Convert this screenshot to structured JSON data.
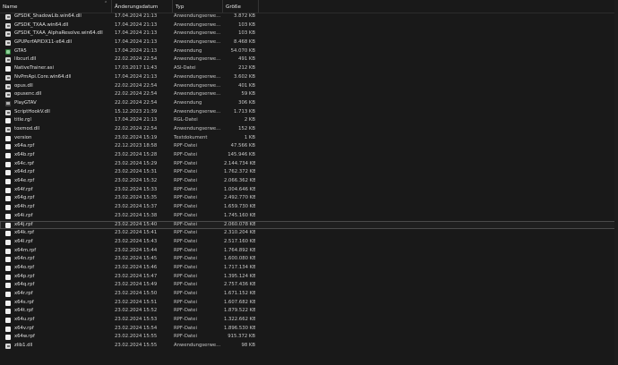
{
  "headers": {
    "name": "Name",
    "date": "Änderungsdatum",
    "type": "Typ",
    "size": "Größe"
  },
  "rows": [
    {
      "name": "GFSDK_ShadowLib.win64.dll",
      "date": "17.04.2024 21:13",
      "type": "Anwendungserwe...",
      "size": "3.872 KB",
      "icon": "dll-icon"
    },
    {
      "name": "GFSDK_TXAA.win64.dll",
      "date": "17.04.2024 21:13",
      "type": "Anwendungserwe...",
      "size": "103 KB",
      "icon": "dll-icon"
    },
    {
      "name": "GFSDK_TXAA_AlphaResolve.win64.dll",
      "date": "17.04.2024 21:13",
      "type": "Anwendungserwe...",
      "size": "103 KB",
      "icon": "dll-icon"
    },
    {
      "name": "GPUPerfAPIDX11-x64.dll",
      "date": "17.04.2024 21:13",
      "type": "Anwendungserwe...",
      "size": "8.468 KB",
      "icon": "dll-icon"
    },
    {
      "name": "GTA5",
      "date": "17.04.2024 21:13",
      "type": "Anwendung",
      "size": "54.070 KB",
      "icon": "app-icon"
    },
    {
      "name": "libcurl.dll",
      "date": "22.02.2024 22:54",
      "type": "Anwendungserwe...",
      "size": "491 KB",
      "icon": "dll-icon"
    },
    {
      "name": "NativeTrainer.asi",
      "date": "17.03.2017 11:43",
      "type": "ASI-Datei",
      "size": "212 KB",
      "icon": "file-icon"
    },
    {
      "name": "NvPmApi.Core.win64.dll",
      "date": "17.04.2024 21:13",
      "type": "Anwendungserwe...",
      "size": "3.602 KB",
      "icon": "dll-icon"
    },
    {
      "name": "opus.dll",
      "date": "22.02.2024 22:54",
      "type": "Anwendungserwe...",
      "size": "401 KB",
      "icon": "dll-icon"
    },
    {
      "name": "opusenc.dll",
      "date": "22.02.2024 22:54",
      "type": "Anwendungserwe...",
      "size": "59 KB",
      "icon": "dll-icon"
    },
    {
      "name": "PlayGTAV",
      "date": "22.02.2024 22:54",
      "type": "Anwendung",
      "size": "306 KB",
      "icon": "app2-icon"
    },
    {
      "name": "ScriptHookV.dll",
      "date": "15.12.2023 21:39",
      "type": "Anwendungserwe...",
      "size": "1.713 KB",
      "icon": "dll-icon"
    },
    {
      "name": "title.rgl",
      "date": "17.04.2024 21:13",
      "type": "RGL-Datei",
      "size": "2 KB",
      "icon": "file-icon"
    },
    {
      "name": "toxmod.dll",
      "date": "22.02.2024 22:54",
      "type": "Anwendungserwe...",
      "size": "152 KB",
      "icon": "dll-icon"
    },
    {
      "name": "version",
      "date": "23.02.2024 15:19",
      "type": "Textdokument",
      "size": "1 KB",
      "icon": "file-icon"
    },
    {
      "name": "x64a.rpf",
      "date": "22.12.2023 18:58",
      "type": "RPF-Datei",
      "size": "47.566 KB",
      "icon": "file-icon"
    },
    {
      "name": "x64b.rpf",
      "date": "23.02.2024 15:28",
      "type": "RPF-Datei",
      "size": "145.946 KB",
      "icon": "file-icon"
    },
    {
      "name": "x64c.rpf",
      "date": "23.02.2024 15:29",
      "type": "RPF-Datei",
      "size": "2.144.734 KB",
      "icon": "file-icon"
    },
    {
      "name": "x64d.rpf",
      "date": "23.02.2024 15:31",
      "type": "RPF-Datei",
      "size": "1.762.372 KB",
      "icon": "file-icon"
    },
    {
      "name": "x64e.rpf",
      "date": "23.02.2024 15:32",
      "type": "RPF-Datei",
      "size": "2.066.362 KB",
      "icon": "file-icon"
    },
    {
      "name": "x64f.rpf",
      "date": "23.02.2024 15:33",
      "type": "RPF-Datei",
      "size": "1.004.646 KB",
      "icon": "file-icon"
    },
    {
      "name": "x64g.rpf",
      "date": "23.02.2024 15:35",
      "type": "RPF-Datei",
      "size": "2.492.770 KB",
      "icon": "file-icon"
    },
    {
      "name": "x64h.rpf",
      "date": "23.02.2024 15:37",
      "type": "RPF-Datei",
      "size": "1.659.730 KB",
      "icon": "file-icon"
    },
    {
      "name": "x64i.rpf",
      "date": "23.02.2024 15:38",
      "type": "RPF-Datei",
      "size": "1.745.160 KB",
      "icon": "file-icon"
    },
    {
      "name": "x64j.rpf",
      "date": "23.02.2024 15:40",
      "type": "RPF-Datei",
      "size": "2.060.078 KB",
      "icon": "file-icon",
      "selected": true
    },
    {
      "name": "x64k.rpf",
      "date": "23.02.2024 15:41",
      "type": "RPF-Datei",
      "size": "2.310.204 KB",
      "icon": "file-icon"
    },
    {
      "name": "x64l.rpf",
      "date": "23.02.2024 15:43",
      "type": "RPF-Datei",
      "size": "2.517.160 KB",
      "icon": "file-icon"
    },
    {
      "name": "x64m.rpf",
      "date": "23.02.2024 15:44",
      "type": "RPF-Datei",
      "size": "1.764.892 KB",
      "icon": "file-icon"
    },
    {
      "name": "x64n.rpf",
      "date": "23.02.2024 15:45",
      "type": "RPF-Datei",
      "size": "1.600.080 KB",
      "icon": "file-icon"
    },
    {
      "name": "x64o.rpf",
      "date": "23.02.2024 15:46",
      "type": "RPF-Datei",
      "size": "1.717.134 KB",
      "icon": "file-icon"
    },
    {
      "name": "x64p.rpf",
      "date": "23.02.2024 15:47",
      "type": "RPF-Datei",
      "size": "1.395.124 KB",
      "icon": "file-icon"
    },
    {
      "name": "x64q.rpf",
      "date": "23.02.2024 15:49",
      "type": "RPF-Datei",
      "size": "2.757.436 KB",
      "icon": "file-icon"
    },
    {
      "name": "x64r.rpf",
      "date": "23.02.2024 15:50",
      "type": "RPF-Datei",
      "size": "1.671.152 KB",
      "icon": "file-icon"
    },
    {
      "name": "x64s.rpf",
      "date": "23.02.2024 15:51",
      "type": "RPF-Datei",
      "size": "1.607.682 KB",
      "icon": "file-icon"
    },
    {
      "name": "x64t.rpf",
      "date": "23.02.2024 15:52",
      "type": "RPF-Datei",
      "size": "1.879.522 KB",
      "icon": "file-icon"
    },
    {
      "name": "x64u.rpf",
      "date": "23.02.2024 15:53",
      "type": "RPF-Datei",
      "size": "1.322.662 KB",
      "icon": "file-icon"
    },
    {
      "name": "x64v.rpf",
      "date": "23.02.2024 15:54",
      "type": "RPF-Datei",
      "size": "1.896.530 KB",
      "icon": "file-icon"
    },
    {
      "name": "x64w.rpf",
      "date": "23.02.2024 15:55",
      "type": "RPF-Datei",
      "size": "915.372 KB",
      "icon": "file-icon"
    },
    {
      "name": "zlib1.dll",
      "date": "23.02.2024 15:55",
      "type": "Anwendungserwe...",
      "size": "98 KB",
      "icon": "dll-icon"
    }
  ]
}
